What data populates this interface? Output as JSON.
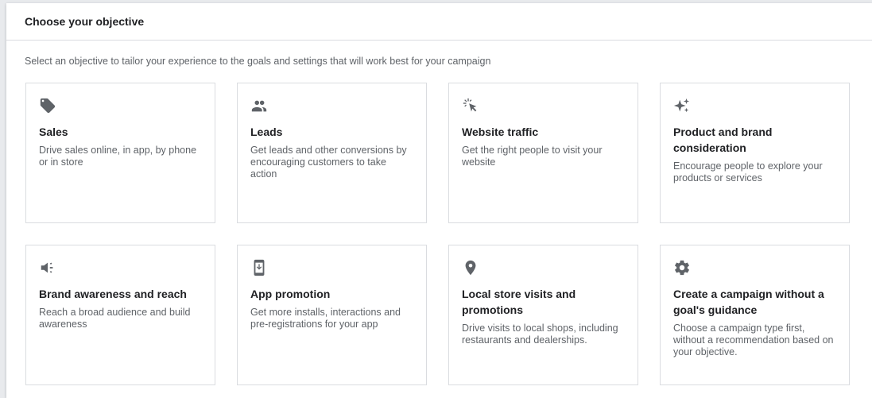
{
  "header": {
    "title": "Choose your objective"
  },
  "subtitle": "Select an objective to tailor your experience to the goals and settings that will work best for your campaign",
  "objectives": [
    {
      "icon": "tag-icon",
      "title": "Sales",
      "desc": "Drive sales online, in app, by phone or in store"
    },
    {
      "icon": "people-icon",
      "title": "Leads",
      "desc": "Get leads and other conversions by encouraging customers to take action"
    },
    {
      "icon": "cursor-click-icon",
      "title": "Website traffic",
      "desc": "Get the right people to visit your website"
    },
    {
      "icon": "sparkle-icon",
      "title": "Product and brand consideration",
      "desc": "Encourage people to explore your products or services"
    },
    {
      "icon": "megaphone-icon",
      "title": "Brand awareness and reach",
      "desc": "Reach a broad audience and build awareness"
    },
    {
      "icon": "phone-download-icon",
      "title": "App promotion",
      "desc": "Get more installs, interactions and pre-registrations for your app"
    },
    {
      "icon": "location-pin-icon",
      "title": "Local store visits and promotions",
      "desc": "Drive visits to local shops, including restaurants and dealerships."
    },
    {
      "icon": "gear-icon",
      "title": "Create a campaign without a goal's guidance",
      "desc": "Choose a campaign type first, without a recommendation based on your objective."
    }
  ]
}
